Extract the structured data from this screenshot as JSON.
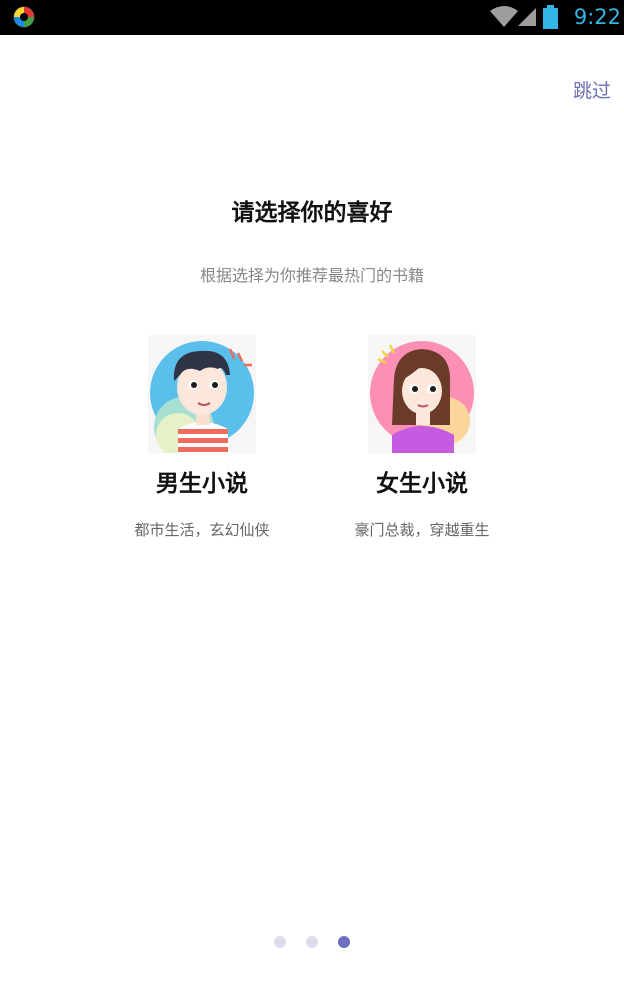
{
  "status_bar": {
    "time": "9:22",
    "icons": [
      "app-icon",
      "wifi-icon",
      "signal-icon",
      "battery-icon"
    ]
  },
  "header": {
    "skip_label": "跳过"
  },
  "main": {
    "title": "请选择你的喜好",
    "subtitle": "根据选择为你推荐最热门的书籍",
    "options": [
      {
        "title": "男生小说",
        "description": "都市生活，玄幻仙侠",
        "avatar": "boy-avatar-icon"
      },
      {
        "title": "女生小说",
        "description": "豪门总裁，穿越重生",
        "avatar": "girl-avatar-icon"
      }
    ]
  },
  "pager": {
    "count": 3,
    "active_index": 2
  },
  "colors": {
    "accent": "#6b6fb4",
    "status_clock": "#33b5e5",
    "dot_active": "#6f6fbf",
    "dot_inactive": "#dcdcee"
  }
}
